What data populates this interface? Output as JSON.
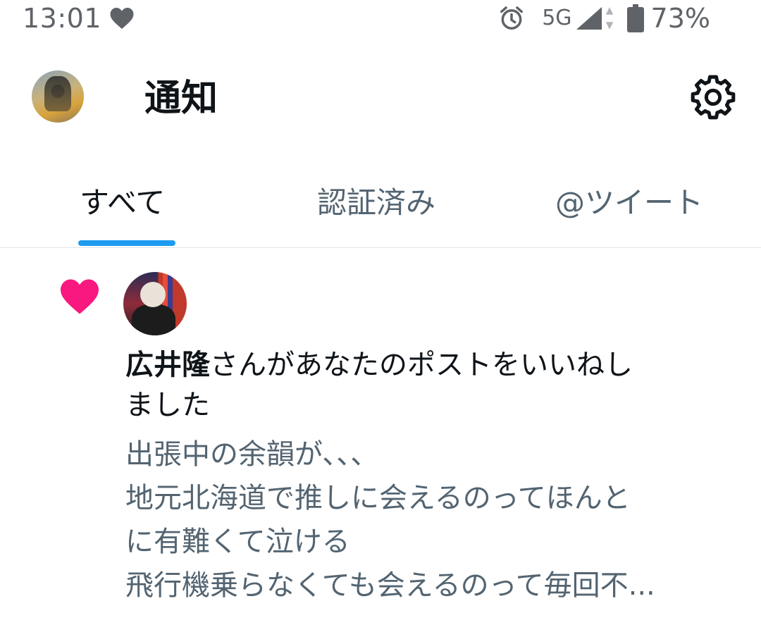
{
  "status_bar": {
    "time": "13:01",
    "network": "5G",
    "battery_percent": "73%",
    "icons": [
      "heart-icon",
      "alarm-icon",
      "signal-icon",
      "data-arrows-icon",
      "battery-icon"
    ]
  },
  "header": {
    "title": "通知",
    "icons": [
      "avatar",
      "gear-icon"
    ]
  },
  "tabs": [
    {
      "label": "すべて",
      "active": true
    },
    {
      "label": "認証済み",
      "active": false
    },
    {
      "label": "@ツイート",
      "active": false
    }
  ],
  "notification": {
    "icon": "heart-icon",
    "user_name": "広井隆",
    "action_text": "さんがあなたのポストをいいねし",
    "action_text_2": "ました",
    "post_lines": [
      "出張中の余韻が、、、",
      "地元北海道で推しに会えるのってほんと",
      "に有難くて泣ける",
      "飛行機乗らなくても会えるのって毎回不..."
    ]
  },
  "colors": {
    "accent": "#1d9bf0",
    "like": "#f91880",
    "text_primary": "#0f1419",
    "text_secondary": "#536471"
  }
}
